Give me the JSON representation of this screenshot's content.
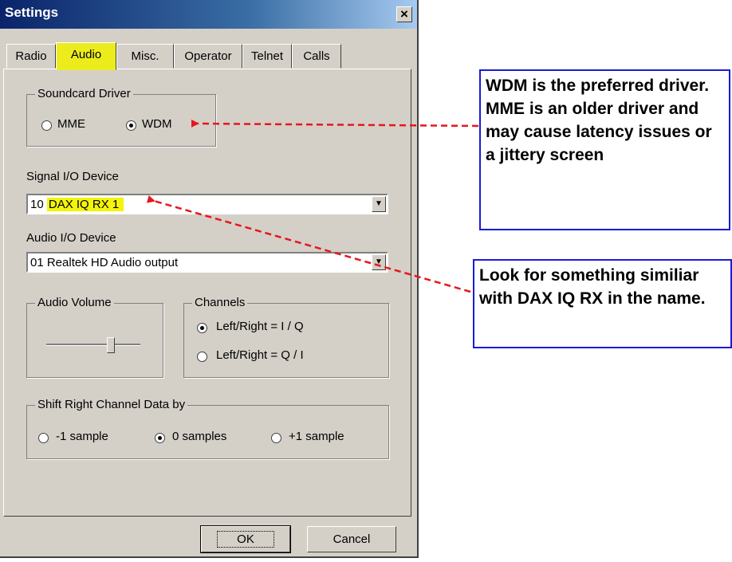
{
  "window": {
    "title": "Settings",
    "close_glyph": "×"
  },
  "tabs": [
    {
      "label": "Radio",
      "active": false
    },
    {
      "label": "Audio",
      "active": true
    },
    {
      "label": "Misc.",
      "active": false
    },
    {
      "label": "Operator",
      "active": false
    },
    {
      "label": "Telnet",
      "active": false
    },
    {
      "label": "Calls",
      "active": false
    }
  ],
  "soundcard_driver": {
    "title": "Soundcard Driver",
    "options": [
      {
        "label": "MME",
        "selected": false
      },
      {
        "label": "WDM",
        "selected": true
      }
    ]
  },
  "signal_device": {
    "label": "Signal I/O Device",
    "num": "10",
    "name": "DAX IQ RX 1"
  },
  "audio_device": {
    "label": "Audio I/O Device",
    "value": "01  Realtek HD Audio output"
  },
  "audio_volume": {
    "title": "Audio Volume",
    "level": 0.7
  },
  "channels": {
    "title": "Channels",
    "options": [
      {
        "label": "Left/Right = I / Q",
        "selected": true
      },
      {
        "label": "Left/Right = Q / I",
        "selected": false
      }
    ]
  },
  "shift": {
    "title": "Shift Right Channel Data by",
    "options": [
      {
        "label": "-1 sample",
        "selected": false
      },
      {
        "label": "0 samples",
        "selected": true
      },
      {
        "label": "+1 sample",
        "selected": false
      }
    ]
  },
  "buttons": {
    "ok": "OK",
    "cancel": "Cancel"
  },
  "annotations": {
    "driver_note": "WDM is the preferred driver.  MME is an older driver and may cause latency issues or a jittery screen",
    "device_note": "Look for something similiar with DAX IQ RX in the name."
  },
  "colors": {
    "highlight": "#f4f40c",
    "arrow": "#e8161c",
    "note_border": "#1a1ad6",
    "title_bar": "#0a246a"
  }
}
